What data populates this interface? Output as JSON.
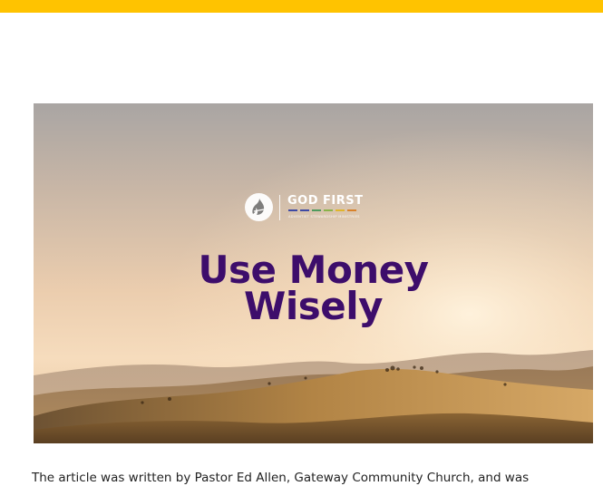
{
  "header": {
    "bar_color": "#ffc300"
  },
  "hero": {
    "logo_icon": "adventist-flame-icon",
    "logo_title": "GOD FIRST",
    "logo_subtitle": "ADVENTIST STEWARDSHIP MINISTRIES",
    "logo_dash_colors": [
      "#3f4aa5",
      "#3f4aa5",
      "#4f9b5e",
      "#8ab34a",
      "#e0b52c",
      "#d9822b"
    ],
    "headline_line1": "Use Money",
    "headline_line2": "Wisely",
    "headline_color": "#3d0d6b"
  },
  "article": {
    "intro_text": "The article was written by Pastor Ed Allen, Gateway Community Church, and was"
  }
}
